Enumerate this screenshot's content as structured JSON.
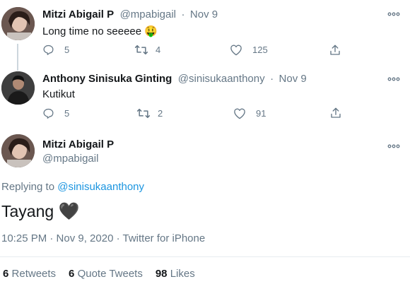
{
  "tweets": [
    {
      "name": "Mitzi Abigail P",
      "handle": "@mpabigail",
      "sep": "·",
      "date": "Nov 9",
      "text": "Long time no seeeee",
      "emoji": "🤑",
      "replies": "5",
      "retweets": "4",
      "likes": "125"
    },
    {
      "name": "Anthony Sinisuka Ginting",
      "handle": "@sinisukaanthony",
      "sep": "·",
      "date": "Nov 9",
      "text": "Kutikut",
      "replies": "5",
      "retweets": "2",
      "likes": "91"
    }
  ],
  "main": {
    "name": "Mitzi Abigail P",
    "handle": "@mpabigail",
    "replying_prefix": "Replying to",
    "replying_to": "@sinisukaanthony",
    "text": "Tayang",
    "heart_emoji": "🖤",
    "meta": "10:25 PM · Nov 9, 2020 · Twitter for iPhone",
    "stats": [
      {
        "num": "6",
        "label": "Retweets"
      },
      {
        "num": "6",
        "label": "Quote Tweets"
      },
      {
        "num": "98",
        "label": "Likes"
      }
    ]
  },
  "colors": {
    "link": "#1b95e0",
    "muted": "#657786",
    "divider": "#e6ecf0"
  },
  "icons": [
    "reply-icon",
    "retweet-icon",
    "like-icon",
    "share-icon",
    "more-icon"
  ]
}
